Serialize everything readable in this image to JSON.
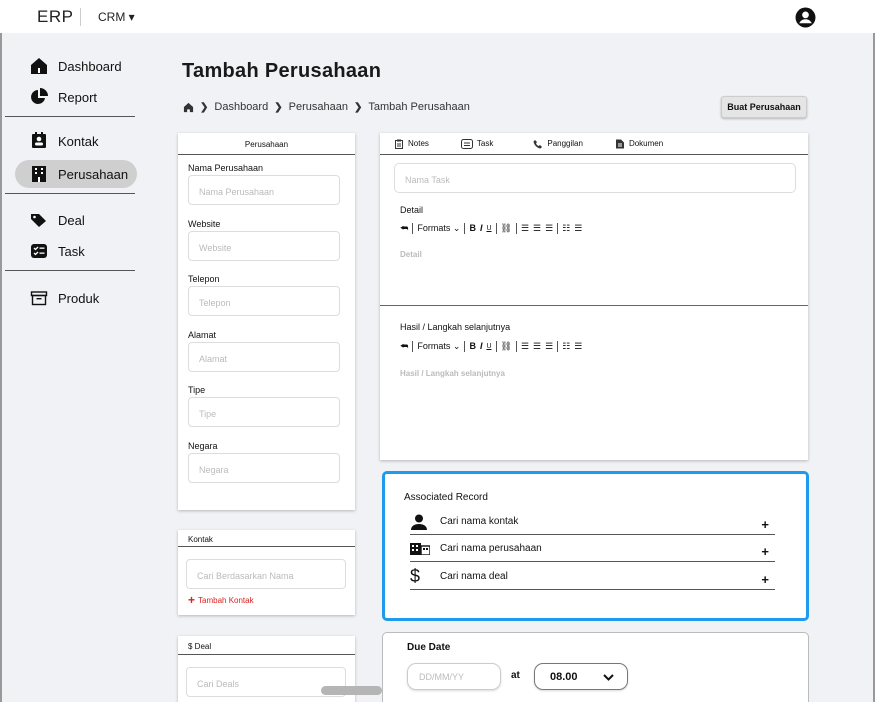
{
  "topbar": {
    "logo": "ERP",
    "module": "CRM ▾"
  },
  "sidebar": {
    "items": [
      {
        "label": "Dashboard",
        "icon": "home-icon"
      },
      {
        "label": "Report",
        "icon": "pie-chart-icon"
      },
      {
        "label": "Kontak",
        "icon": "contact-card-icon"
      },
      {
        "label": "Perusahaan",
        "icon": "building-icon"
      },
      {
        "label": "Deal",
        "icon": "tags-icon"
      },
      {
        "label": "Task",
        "icon": "checklist-icon"
      },
      {
        "label": "Produk",
        "icon": "archive-box-icon"
      }
    ]
  },
  "page": {
    "title": "Tambah Perusahaan",
    "breadcrumb": [
      "Dashboard",
      "Perusahaan",
      "Tambah Perusahaan"
    ],
    "create_button": "Buat Perusahaan"
  },
  "company_form": {
    "header": "Perusahaan",
    "fields": [
      {
        "label": "Nama Perusahaan",
        "placeholder": "Nama Perusahaan"
      },
      {
        "label": "Website",
        "placeholder": "Website"
      },
      {
        "label": "Telepon",
        "placeholder": "Telepon"
      },
      {
        "label": "Alamat",
        "placeholder": "Alamat"
      },
      {
        "label": "Tipe",
        "placeholder": "Tipe"
      },
      {
        "label": "Negara",
        "placeholder": "Negara"
      }
    ]
  },
  "contact_card": {
    "header": "Kontak",
    "placeholder": "Cari Berdasarkan Nama",
    "add_link": "Tambah Kontak"
  },
  "deal_card": {
    "header": "$ Deal",
    "placeholder": "Cari Deals"
  },
  "activity": {
    "tabs": [
      {
        "label": "Notes",
        "icon": "clipboard-icon"
      },
      {
        "label": "Task",
        "icon": "task-icon"
      },
      {
        "label": "Panggilan",
        "icon": "phone-icon"
      },
      {
        "label": "Dokumen",
        "icon": "document-icon"
      }
    ],
    "task_placeholder": "Nama Task",
    "detail_label": "Detail",
    "detail_placeholder": "Detail",
    "result_label": "Hasil / Langkah selanjutnya",
    "result_placeholder": "Hasil / Langkah selanjutnya",
    "toolbar_formats": "Formats"
  },
  "associated": {
    "title": "Associated Record",
    "rows": [
      {
        "label": "Cari nama kontak",
        "icon": "person-icon"
      },
      {
        "label": "Cari nama perusahaan",
        "icon": "building-icon"
      },
      {
        "label": "Cari nama deal",
        "icon": "dollar-icon"
      }
    ]
  },
  "due": {
    "title": "Due Date",
    "date_placeholder": "DD/MM/YY",
    "at": "at",
    "time": "08.00"
  },
  "colors": {
    "accent_border": "#1e9bec",
    "danger": "#e02020"
  }
}
